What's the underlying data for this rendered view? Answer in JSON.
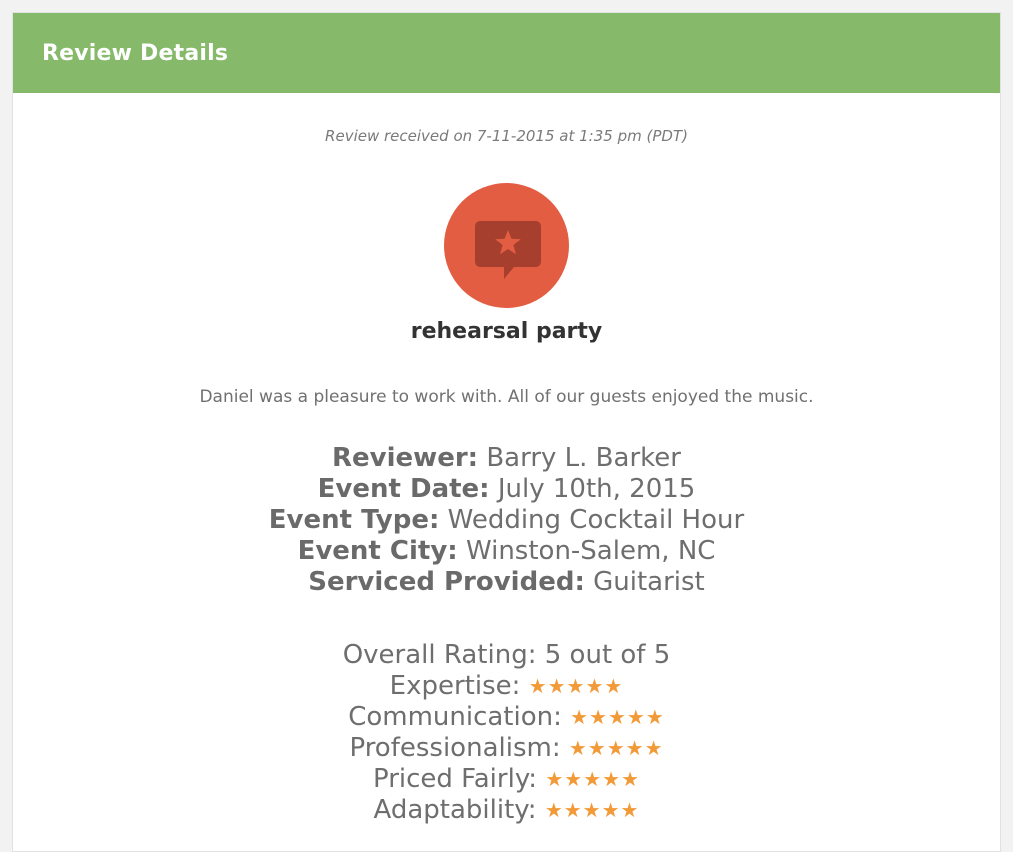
{
  "header": {
    "title": "Review Details"
  },
  "review": {
    "received": "Review received on 7-11-2015 at 1:35 pm (PDT)",
    "icon": "star-speech-bubble-icon",
    "title": "rehearsal party",
    "comment": "Daniel was a pleasure to work with. All of our guests enjoyed the music."
  },
  "details": [
    {
      "label": "Reviewer:",
      "value": "Barry L. Barker"
    },
    {
      "label": "Event Date:",
      "value": "July 10th, 2015"
    },
    {
      "label": "Event Type:",
      "value": "Wedding Cocktail Hour"
    },
    {
      "label": "Event City:",
      "value": "Winston-Salem, NC"
    },
    {
      "label": "Serviced Provided:",
      "value": "Guitarist"
    }
  ],
  "ratings": {
    "overall_label": "Overall Rating:",
    "overall_value": "5 out of 5",
    "categories": [
      {
        "label": "Expertise:",
        "stars": "★★★★★",
        "rating": 5
      },
      {
        "label": "Communication:",
        "stars": "★★★★★",
        "rating": 5
      },
      {
        "label": "Professionalism:",
        "stars": "★★★★★",
        "rating": 5
      },
      {
        "label": "Priced Fairly:",
        "stars": "★★★★★",
        "rating": 5
      },
      {
        "label": "Adaptability:",
        "stars": "★★★★★",
        "rating": 5
      }
    ]
  },
  "colors": {
    "header_bg": "#86b96a",
    "icon_bg": "#e35d43",
    "star": "#f29a38"
  }
}
